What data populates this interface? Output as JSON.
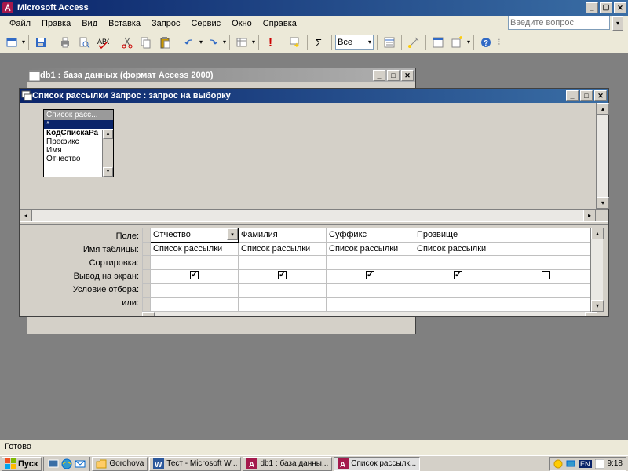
{
  "app": {
    "title": "Microsoft Access"
  },
  "menu": {
    "file": "Файл",
    "edit": "Правка",
    "view": "Вид",
    "insert": "Вставка",
    "query": "Запрос",
    "tools": "Сервис",
    "window": "Окно",
    "help": "Справка",
    "help_placeholder": "Введите вопрос"
  },
  "toolbar": {
    "combo_value": "Все"
  },
  "db_window": {
    "title": "db1 : база данных (формат Access 2000)"
  },
  "query_window": {
    "title": "Список рассылки Запрос : запрос на выборку",
    "source_table": {
      "name": "Список расс...",
      "fields": [
        "*",
        "КодСпискаРа",
        "Префикс",
        "Имя",
        "Отчество"
      ]
    },
    "grid": {
      "labels": {
        "field": "Поле:",
        "table": "Имя таблицы:",
        "sort": "Сортировка:",
        "show": "Вывод на экран:",
        "criteria": "Условие отбора:",
        "or": "или:"
      },
      "columns": [
        {
          "field": "Отчество",
          "table": "Список рассылки",
          "show": true,
          "selected": true
        },
        {
          "field": "Фамилия",
          "table": "Список рассылки",
          "show": true
        },
        {
          "field": "Суффикс",
          "table": "Список рассылки",
          "show": true
        },
        {
          "field": "Прозвище",
          "table": "Список рассылки",
          "show": true
        },
        {
          "field": "",
          "table": "",
          "show": false
        }
      ]
    }
  },
  "statusbar": {
    "text": "Готово"
  },
  "taskbar": {
    "start": "Пуск",
    "folder": "Gorohova",
    "tasks": [
      {
        "icon": "word",
        "label": "Тест - Microsoft W..."
      },
      {
        "icon": "access",
        "label": "db1 : база данны..."
      },
      {
        "icon": "access",
        "label": "Список рассылк...",
        "active": true
      }
    ],
    "lang": "EN",
    "clock": "9:18"
  }
}
